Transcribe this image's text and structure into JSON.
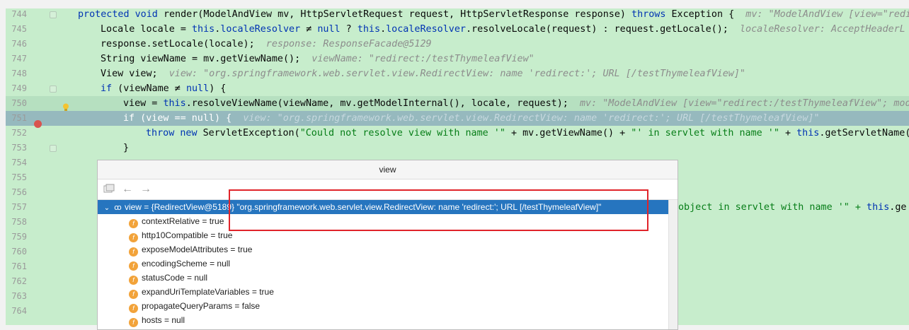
{
  "editor": {
    "lines": [
      {
        "num": "744",
        "segments": [
          {
            "t": "protected void ",
            "c": "kw"
          },
          {
            "t": "render(ModelAndView mv, HttpServletRequest request, HttpServletResponse response) ",
            "c": ""
          },
          {
            "t": "throws ",
            "c": "kw"
          },
          {
            "t": "Exception {  ",
            "c": ""
          },
          {
            "t": "mv: \"ModelAndView [view=\"redi",
            "c": "hint"
          }
        ]
      },
      {
        "num": "745",
        "segments": [
          {
            "t": "Locale locale = ",
            "c": ""
          },
          {
            "t": "this",
            "c": "kw"
          },
          {
            "t": ".",
            "c": ""
          },
          {
            "t": "localeResolver",
            "c": "kw"
          },
          {
            "t": " ≠ ",
            "c": ""
          },
          {
            "t": "null",
            "c": "kw"
          },
          {
            "t": " ? ",
            "c": ""
          },
          {
            "t": "this",
            "c": "kw"
          },
          {
            "t": ".",
            "c": ""
          },
          {
            "t": "localeResolver",
            "c": "kw"
          },
          {
            "t": ".resolveLocale(request) : request.getLocale();  ",
            "c": ""
          },
          {
            "t": "localeResolver: AcceptHeaderL",
            "c": "hint"
          }
        ]
      },
      {
        "num": "746",
        "segments": [
          {
            "t": "response.setLocale(locale);  ",
            "c": ""
          },
          {
            "t": "response: ResponseFacade@5129",
            "c": "hint"
          }
        ]
      },
      {
        "num": "747",
        "segments": [
          {
            "t": "String viewName = mv.getViewName();  ",
            "c": ""
          },
          {
            "t": "viewName: \"redirect:/testThymeleafView\"",
            "c": "hint"
          }
        ]
      },
      {
        "num": "748",
        "segments": [
          {
            "t": "View view;  ",
            "c": ""
          },
          {
            "t": "view: \"org.springframework.web.servlet.view.RedirectView: name 'redirect:'; URL [/testThymeleafView]\"",
            "c": "hint"
          }
        ]
      },
      {
        "num": "749",
        "segments": [
          {
            "t": "if",
            "c": "kw"
          },
          {
            "t": " (viewName ≠ ",
            "c": ""
          },
          {
            "t": "null",
            "c": "kw"
          },
          {
            "t": ") {",
            "c": ""
          }
        ]
      },
      {
        "num": "750",
        "segments": [
          {
            "t": "view = ",
            "c": ""
          },
          {
            "t": "this",
            "c": "kw"
          },
          {
            "t": ".resolveViewName(viewName, mv.getModelInternal(), locale, request);  ",
            "c": ""
          },
          {
            "t": "mv: \"ModelAndView [view=\"redirect:/testThymeleafView\"; mod",
            "c": "hint"
          }
        ]
      },
      {
        "num": "751",
        "segments": [
          {
            "t": "if",
            "c": "kw"
          },
          {
            "t": " (view == ",
            "c": ""
          },
          {
            "t": "null",
            "c": "kw"
          },
          {
            "t": ") {  ",
            "c": ""
          },
          {
            "t": "view: \"org.springframework.web.servlet.view.RedirectView: name 'redirect:'; URL [/testThymeleafView]\"",
            "c": "hint"
          }
        ]
      },
      {
        "num": "752",
        "segments": [
          {
            "t": "throw new ",
            "c": "kw"
          },
          {
            "t": "ServletException(",
            "c": ""
          },
          {
            "t": "\"Could not resolve view with name '\"",
            "c": "str"
          },
          {
            "t": " + mv.getViewName() + ",
            "c": ""
          },
          {
            "t": "\"' in servlet with name '\"",
            "c": "str"
          },
          {
            "t": " + ",
            "c": ""
          },
          {
            "t": "this",
            "c": "kw"
          },
          {
            "t": ".getServletName(",
            "c": ""
          }
        ]
      },
      {
        "num": "753",
        "segments": [
          {
            "t": "}",
            "c": ""
          }
        ]
      },
      {
        "num": "754",
        "segments": []
      },
      {
        "num": "755",
        "segments": []
      },
      {
        "num": "756",
        "segments": []
      },
      {
        "num": "757",
        "segments": [
          {
            "t": "object in servlet with name '\" + ",
            "c": "str"
          },
          {
            "t": "this",
            "c": "kw"
          },
          {
            "t": ".ge",
            "c": ""
          }
        ]
      },
      {
        "num": "758",
        "segments": []
      },
      {
        "num": "759",
        "segments": []
      },
      {
        "num": "760",
        "segments": []
      },
      {
        "num": "761",
        "segments": []
      },
      {
        "num": "762",
        "segments": []
      },
      {
        "num": "763",
        "segments": []
      },
      {
        "num": "764",
        "segments": []
      }
    ]
  },
  "popup": {
    "title": "view",
    "toolbar": {
      "icons": [
        "watch-icon",
        "back-icon",
        "forward-icon"
      ]
    },
    "tree": {
      "root": {
        "arrow": "⌄",
        "name": "view",
        "value": " = {RedirectView@5189} \"org.springframework.web.servlet.view.RedirectView: name 'redirect:'; URL [/testThymeleafView]\""
      },
      "fields": [
        {
          "name": "contextRelative",
          "value": " = true"
        },
        {
          "name": "http10Compatible",
          "value": " = true"
        },
        {
          "name": "exposeModelAttributes",
          "value": " = true"
        },
        {
          "name": "encodingScheme",
          "value": " = null"
        },
        {
          "name": "statusCode",
          "value": " = null"
        },
        {
          "name": "expandUriTemplateVariables",
          "value": " = true"
        },
        {
          "name": "propagateQueryParams",
          "value": " = false"
        },
        {
          "name": "hosts",
          "value": " = null"
        }
      ]
    }
  },
  "colors": {
    "editor_bg": "#c7edcc",
    "highlight": "#96b9be",
    "selection": "#2675bf",
    "annotation": "#e0242a"
  }
}
